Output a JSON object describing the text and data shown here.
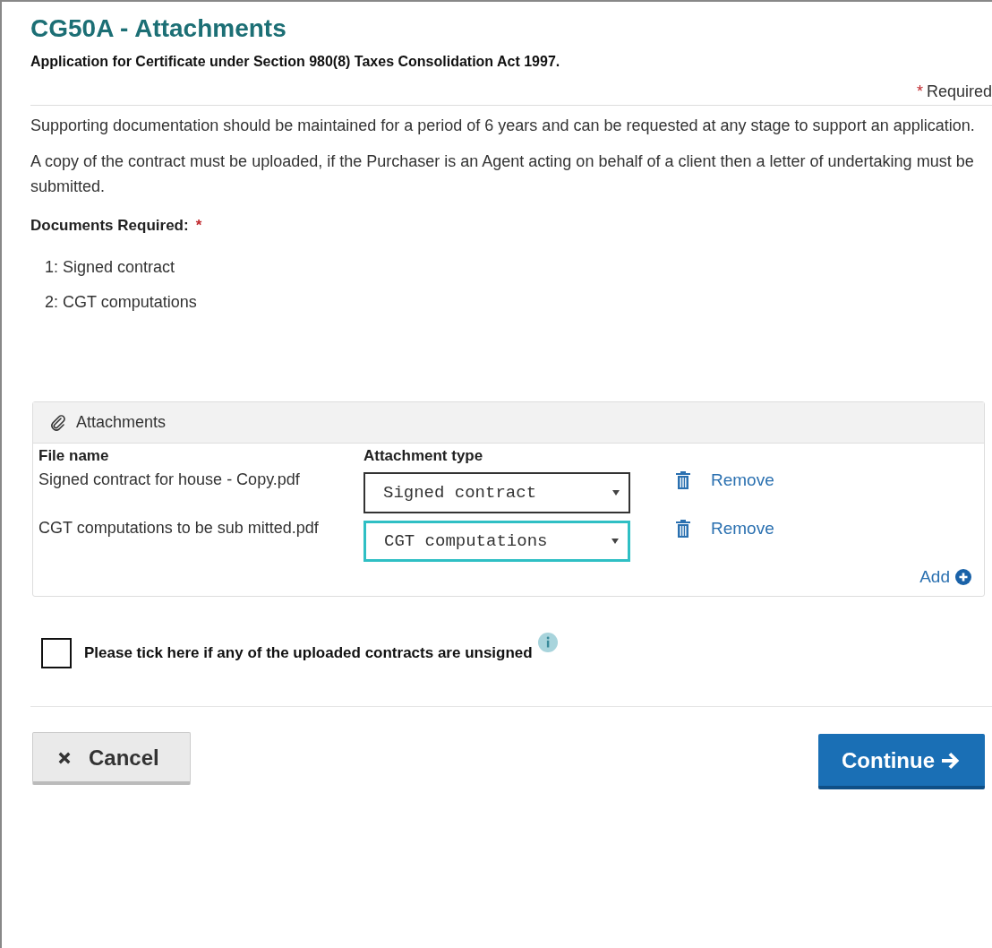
{
  "title": "CG50A - Attachments",
  "subtitle": "Application for Certificate under Section 980(8) Taxes Consolidation Act 1997.",
  "required_note": {
    "mark": "*",
    "label": "Required"
  },
  "paragraphs": [
    "Supporting documentation should be maintained for a period of 6 years and can be requested at any stage to support an application.",
    "A copy of the contract must be uploaded, if the Purchaser is an Agent acting on behalf of a client then a letter of undertaking must be submitted."
  ],
  "documents_required": {
    "label": "Documents Required:",
    "mark": "*",
    "items": [
      "1: Signed contract",
      "2: CGT computations"
    ]
  },
  "attachments_panel": {
    "title": "Attachments",
    "columns": [
      "File name",
      "Attachment type"
    ],
    "rows": [
      {
        "file_name": "Signed contract for house - Copy.pdf",
        "attachment_type": "Signed contract",
        "focused": false,
        "action": "Remove"
      },
      {
        "file_name": "CGT computations to be sub mitted.pdf",
        "attachment_type": "CGT computations",
        "focused": true,
        "action": "Remove"
      }
    ],
    "add_link": "Add"
  },
  "unsigned_checkbox": {
    "label": "Please tick here if any of the uploaded contracts are unsigned",
    "checked": false
  },
  "buttons": {
    "cancel": "Cancel",
    "continue": "Continue"
  }
}
